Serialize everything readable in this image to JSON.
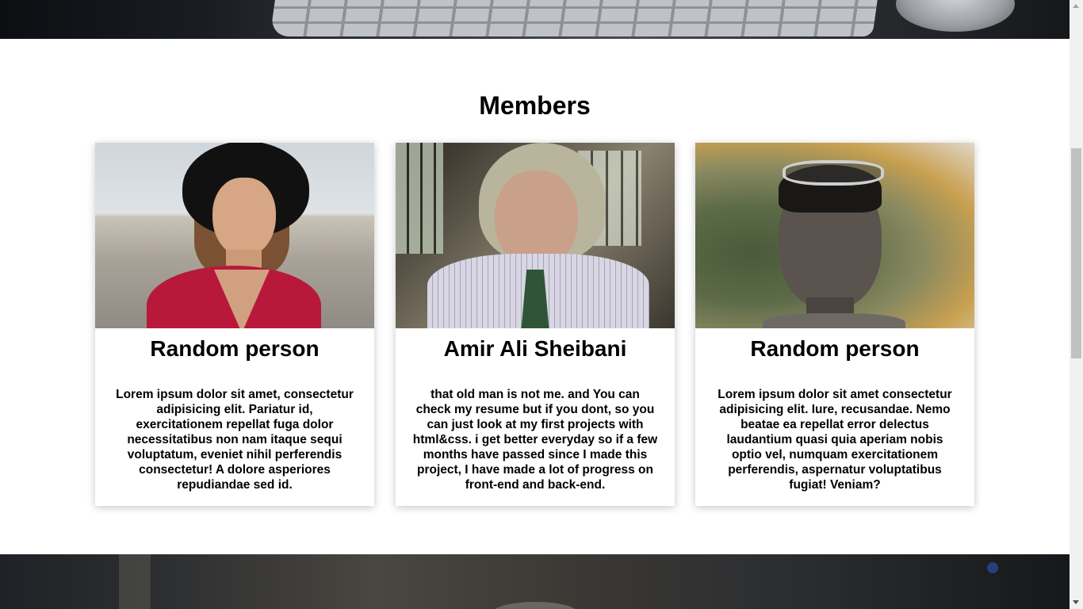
{
  "section": {
    "title": "Members"
  },
  "members": [
    {
      "name": "Random person",
      "description": "Lorem ipsum dolor sit amet, consectetur adipisicing elit. Pariatur id, exercitationem repellat fuga dolor necessitatibus non nam itaque sequi voluptatum, eveniet nihil perferendis consectetur! A dolore asperiores repudiandae sed id."
    },
    {
      "name": "Amir Ali Sheibani",
      "description": "that old man is not me. and You can check my resume but if you dont, so you can just look at my first projects with html&css. i get better everyday so if a few months have passed since I made this project, I have made a lot of progress on front-end and back-end."
    },
    {
      "name": "Random person",
      "description": "Lorem ipsum dolor sit amet consectetur adipisicing elit. Iure, recusandae. Nemo beatae ea repellat error delectus laudantium quasi quia aperiam nobis optio vel, numquam exercitationem perferendis, aspernatur voluptatibus fugiat! Veniam?"
    }
  ],
  "colors": {
    "background": "#ffffff",
    "text": "#000000",
    "card_shadow": "rgba(0,0,0,0.22)",
    "scrollbar_track": "#f1f1f1",
    "scrollbar_thumb": "#c1c1c1"
  },
  "icons": {
    "scroll_up": "triangle-up",
    "scroll_down": "triangle-down"
  }
}
